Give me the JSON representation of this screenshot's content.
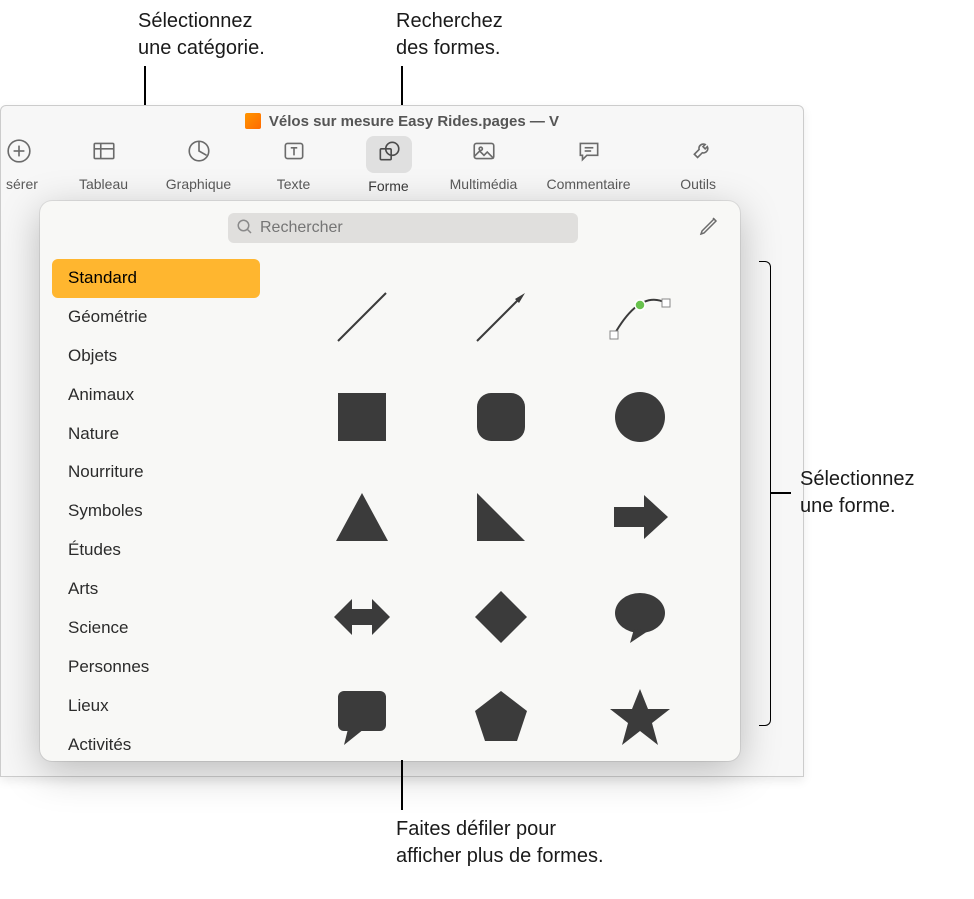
{
  "callouts": {
    "select_category": "Sélectionnez\nune catégorie.",
    "search_shapes": "Recherchez\ndes formes.",
    "select_shape": "Sélectionnez\nune forme.",
    "scroll_more": "Faites défiler pour\nafficher plus de formes."
  },
  "document": {
    "title": "Vélos sur mesure Easy Rides.pages — V"
  },
  "toolbar": {
    "items": [
      {
        "label": "sérer"
      },
      {
        "label": "Tableau"
      },
      {
        "label": "Graphique"
      },
      {
        "label": "Texte"
      },
      {
        "label": "Forme"
      },
      {
        "label": "Multimédia"
      },
      {
        "label": "Commentaire"
      },
      {
        "label": "Outils"
      }
    ]
  },
  "popover": {
    "search_placeholder": "Rechercher",
    "categories": [
      "Standard",
      "Géométrie",
      "Objets",
      "Animaux",
      "Nature",
      "Nourriture",
      "Symboles",
      "Études",
      "Arts",
      "Science",
      "Personnes",
      "Lieux",
      "Activités"
    ],
    "selected_category_index": 0,
    "shapes": [
      "line",
      "arrow-line",
      "curve",
      "square",
      "rounded-square",
      "circle",
      "triangle",
      "right-triangle",
      "arrow-right",
      "arrow-leftright",
      "diamond",
      "speech-bubble",
      "callout-square",
      "pentagon",
      "star"
    ]
  },
  "colors": {
    "selection": "#ffb62f",
    "shape_fill": "#3b3b3b"
  }
}
